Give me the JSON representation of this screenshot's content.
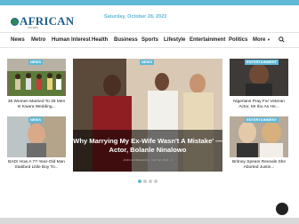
{
  "header": {
    "logo_text": "AFRICAN",
    "logo_sub": "CELEBS",
    "date": "Saturday, October 28, 2023"
  },
  "nav": {
    "items": [
      "News",
      "Metro",
      "Human Interest",
      "Health",
      "Business",
      "Sports",
      "Lifestyle",
      "Entertainment",
      "Politics",
      "More"
    ],
    "more_icon": "chevron-down-icon",
    "search_icon": "search-icon"
  },
  "left": {
    "posts": [
      {
        "badge": "NEWS",
        "title": "36 Women Married To 36 Men In Kwara Wedding..."
      },
      {
        "badge": "NEWS",
        "title": "BAD! How A 77-Year-Old Man Stabbed Little Boy To..."
      }
    ]
  },
  "hero": {
    "badge": "NEWS",
    "title": "Why Marrying My Ex-Wife Wasn't A Mistake' —Actor, Bolanle Ninalowo",
    "meta": "AFRICAN BREAKING · OCT 28, 2023 · 0",
    "slides": 4,
    "active_slide": 1
  },
  "right": {
    "posts": [
      {
        "badge": "ENTERTAINMENT",
        "title": "Nigerians Pray For Veteran Actor, Mr Ibu As He..."
      },
      {
        "badge": "ENTERTAINMENT",
        "title": "Britney Spears Reveals She Aborted Justin..."
      }
    ]
  },
  "colors": {
    "accent": "#5fb8d6",
    "text": "#222222"
  }
}
